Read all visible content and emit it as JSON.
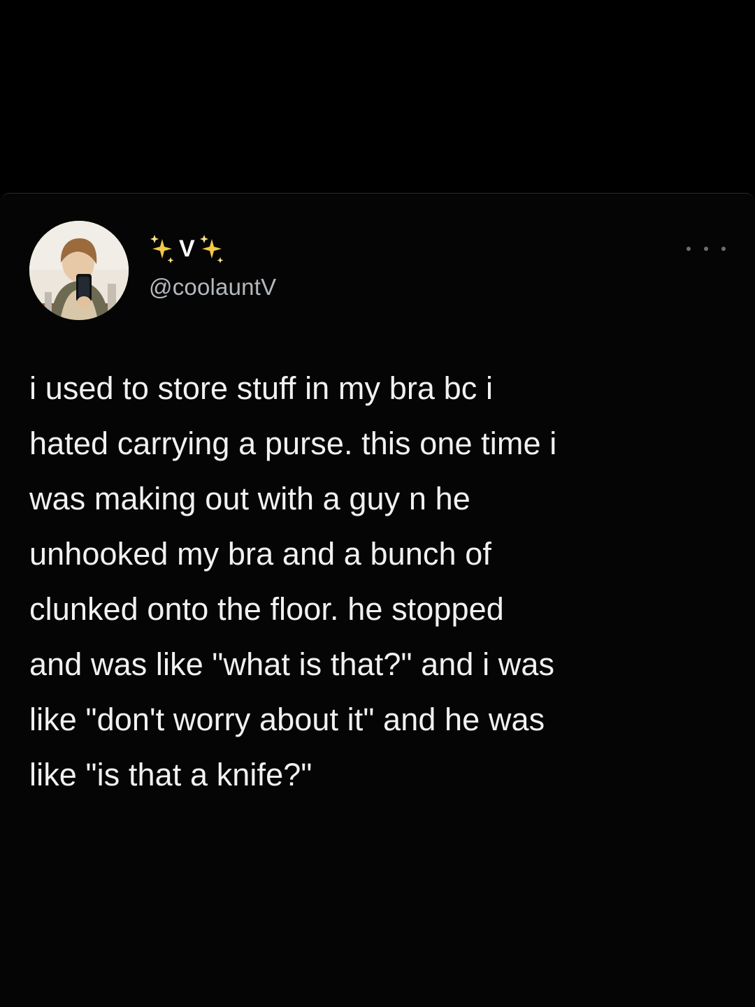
{
  "tweet": {
    "display_name": "V",
    "handle": "@coolauntV",
    "more_icon": "more-horizontal-icon",
    "avatar_icon": "user-avatar-photo",
    "name_decoration_icon": "sparkles-icon",
    "text_lines": [
      "i used to store stuff in my bra bc i",
      "hated carrying a purse. this one time i",
      "was making out with a guy n he",
      "unhooked my bra and a bunch of",
      "clunked onto the floor. he stopped",
      "and was like \"what is that?\" and i was",
      "like \"don't worry about it\" and he was",
      "like \"is that a knife?\""
    ]
  },
  "colors": {
    "background": "#000000",
    "text": "#f1f1f1",
    "handle": "#b4b8bd",
    "sparkle": "#f3c94a"
  }
}
